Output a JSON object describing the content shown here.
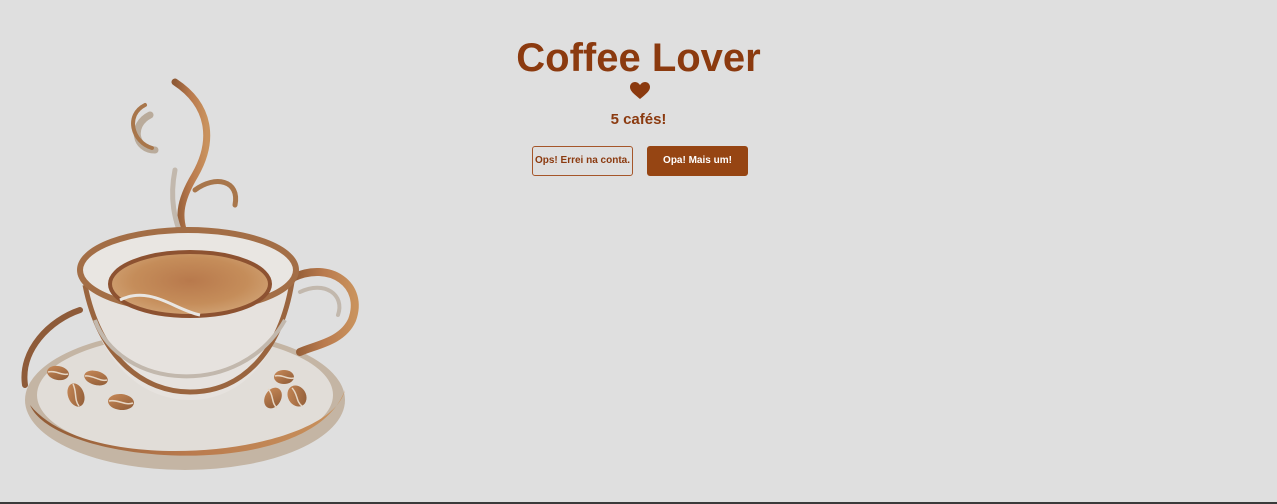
{
  "app": {
    "title": "Coffee Lover",
    "heart_icon": "heart-icon",
    "counter_text": "5 cafés!"
  },
  "actions": {
    "decrement_label": "Ops! Errei na conta.",
    "increment_label": "Opa! Mais um!"
  },
  "colors": {
    "background": "#dfdfdf",
    "brand_brown": "#8b3a0f",
    "button_brown": "#964513",
    "button_text": "#ffffff"
  },
  "illustration": {
    "icon": "coffee-cup-illustration"
  }
}
